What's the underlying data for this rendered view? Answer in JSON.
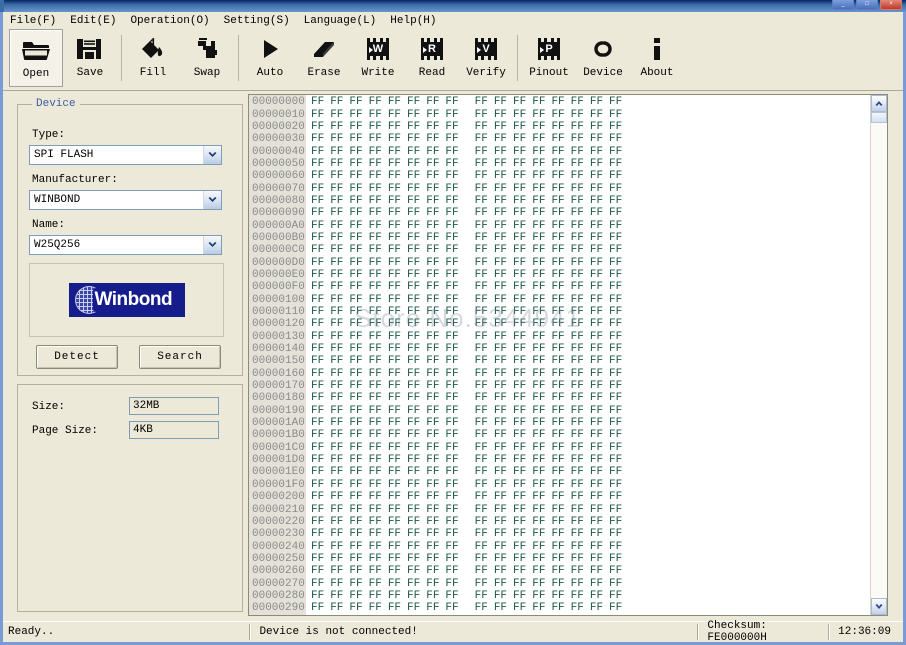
{
  "window": {
    "buttons": [
      {
        "name": "minimize",
        "glyph": "_"
      },
      {
        "name": "maximize",
        "glyph": "□"
      },
      {
        "name": "close",
        "glyph": "×"
      }
    ]
  },
  "menu": {
    "items": [
      {
        "label": "File(F)",
        "text": "File",
        "key": "F"
      },
      {
        "label": "Edit(E)",
        "text": "Edit",
        "key": "E"
      },
      {
        "label": "Operation(O)",
        "text": "Operation",
        "key": "O"
      },
      {
        "label": "Setting(S)",
        "text": "Setting",
        "key": "S"
      },
      {
        "label": "Language(L)",
        "text": "Language",
        "key": "L"
      },
      {
        "label": "Help(H)",
        "text": "Help",
        "key": "H"
      }
    ]
  },
  "toolbar": {
    "buttons": [
      {
        "label": "Open",
        "icon": "folder-open-icon",
        "pressed": true
      },
      {
        "label": "Save",
        "icon": "floppy-disk-icon",
        "pressed": false
      },
      {
        "label": "Fill",
        "icon": "paint-bucket-icon",
        "pressed": false
      },
      {
        "label": "Swap",
        "icon": "swap-icon",
        "pressed": false
      },
      {
        "label": "Auto",
        "icon": "play-triangle-icon",
        "pressed": false
      },
      {
        "label": "Erase",
        "icon": "eraser-icon",
        "pressed": false
      },
      {
        "label": "Write",
        "icon": "chip-w-icon",
        "letter": "W",
        "pressed": false
      },
      {
        "label": "Read",
        "icon": "chip-r-icon",
        "letter": "R",
        "pressed": false
      },
      {
        "label": "Verify",
        "icon": "chip-v-icon",
        "letter": "V",
        "pressed": false
      },
      {
        "label": "Pinout",
        "icon": "chip-p-icon",
        "letter": "P",
        "pressed": false
      },
      {
        "label": "Device",
        "icon": "chain-link-icon",
        "pressed": false
      },
      {
        "label": "About",
        "icon": "info-i-icon",
        "pressed": false
      }
    ]
  },
  "device_panel": {
    "group_title": "Device",
    "type_label": "Type:",
    "type_value": "SPI FLASH",
    "manufacturer_label": "Manufacturer:",
    "manufacturer_value": "WINBOND",
    "name_label": "Name:",
    "name_value": "W25Q256",
    "logo_text": "Winbond",
    "detect_button": "Detect",
    "search_button": "Search"
  },
  "info_panel": {
    "size_label": "Size:",
    "size_value": "32MB",
    "page_size_label": "Page Size:",
    "page_size_value": "4KB"
  },
  "hex_view": {
    "watermark": "Store No.5344941",
    "byte_value": "FF",
    "bytes_per_row": 16,
    "row_count": 42,
    "start_address": 0,
    "address_step": 16,
    "addresses": [
      "00000000",
      "00000010",
      "00000020",
      "00000030",
      "00000040",
      "00000050",
      "00000060",
      "00000070",
      "00000080",
      "00000090",
      "000000A0",
      "000000B0",
      "000000C0",
      "000000D0",
      "000000E0",
      "000000F0",
      "00000100",
      "00000110",
      "00000120",
      "00000130",
      "00000140",
      "00000150",
      "00000160",
      "00000170",
      "00000180",
      "00000190",
      "000001A0",
      "000001B0",
      "000001C0",
      "000001D0",
      "000001E0",
      "000001F0",
      "00000200",
      "00000210",
      "00000220",
      "00000230",
      "00000240",
      "00000250",
      "00000260",
      "00000270",
      "00000280",
      "00000290"
    ]
  },
  "status_bar": {
    "ready_text": "Ready..",
    "device_text": "Device is not connected!",
    "checksum_text": "Checksum: FE000000H",
    "time_text": "12:36:09"
  },
  "colors": {
    "face": "#ece9d8",
    "hex_text": "#1f5a46",
    "addr_text": "#8a8a8a",
    "addr_bg": "#e4e2d8",
    "group_title": "#3b5fa0",
    "winbond_blue": "#151c8c",
    "title_blue": "#3b6ea5"
  }
}
